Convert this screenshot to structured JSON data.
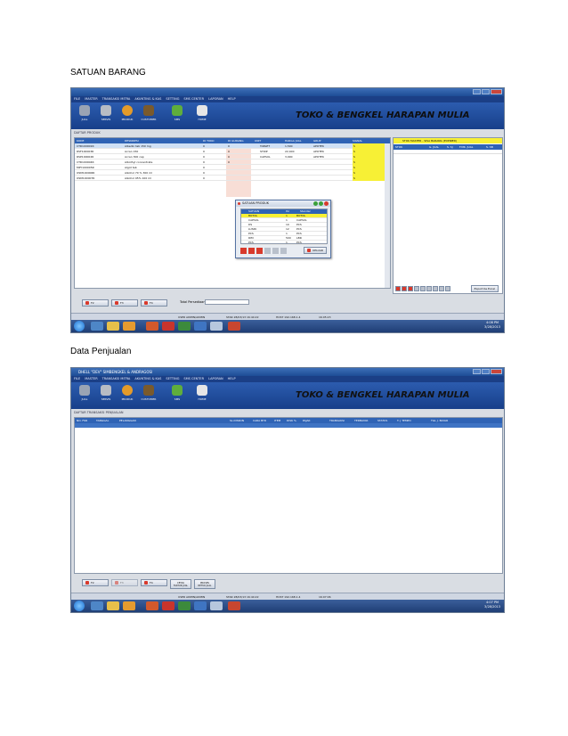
{
  "captions": {
    "first": "SATUAN BARANG",
    "second": "Data Penjualan"
  },
  "app": {
    "menu": [
      "FILE",
      "MASTER",
      "TRANSAKSI MITRA",
      "AKUNTING & KAS",
      "SETTING",
      "SMS CENTER",
      "LAPORAN",
      "HELP"
    ],
    "toolbar": [
      "JUAL",
      "SERVIS",
      "PRODUK",
      "CUSTOMER",
      "SMS",
      "HOME"
    ],
    "brand": "TOKO & BENGKEL HARAPAN MULIA"
  },
  "shot1": {
    "panel_title": "DAFTAR PRODUK",
    "columns": [
      "KODE",
      "DESKRIPSI",
      "DI TOKO",
      "DI GUDANG",
      "UNIT",
      "HARGA JUAL",
      "GRUP",
      "SIGNAL"
    ],
    "rows": [
      [
        "CTR100001R",
        "Albedin tab 150 mg",
        "0",
        "0",
        "TABLET",
        "1,500",
        "APOTEK",
        "S"
      ],
      [
        "RSF100003R",
        "Acran 150",
        "0",
        "0",
        "STRIP",
        "22,400",
        "APOTEK",
        "S"
      ],
      [
        "RSP100002R",
        "Acran 300 cap",
        "0",
        "0",
        "CAPSUL",
        "3,990",
        "APOTEK",
        "S"
      ],
      [
        "CTR100004R",
        "Albothyl concentrate",
        "0",
        "0",
        "",
        "",
        "",
        "S"
      ],
      [
        "MPY100005R",
        "Algot tab",
        "0",
        "",
        "",
        "",
        "",
        "S"
      ],
      [
        "OSM100006R",
        "Alkohol 70 % 300 ml",
        "0",
        "",
        "",
        "",
        "",
        "S"
      ],
      [
        "OSM100007R",
        "Alkohol 95% 100 ml",
        "0",
        "",
        "",
        "",
        "",
        "S"
      ]
    ],
    "side_title": "STOK MASTER - SISA BARANG (EXPIRED)",
    "side_columns": [
      "STOK",
      "G. JUAL",
      "S. SJ",
      "F.MK. JUAL",
      "S. SB"
    ],
    "side_button": "Export Ke Excel",
    "dialog": {
      "title": "SATUAN PRODUK",
      "columns": [
        "SATUAN",
        "ISI",
        "Standar"
      ],
      "rows": [
        [
          "BOTOL",
          "1",
          "BOTOL"
        ],
        [
          "CAPSUL",
          "1",
          "CAPSUL"
        ],
        [
          "DS",
          "10",
          "PCS"
        ],
        [
          "LUSIN",
          "12",
          "PCS"
        ],
        [
          "PCS",
          "1",
          "PCS"
        ],
        [
          "RIM",
          "500",
          "LBR"
        ],
        [
          "PCS",
          "1",
          "PCS"
        ]
      ],
      "close_label": "KELUAR"
    },
    "buttons": [
      "F2",
      "F3",
      "F4"
    ],
    "total_label": "Total Persediaan :",
    "status": [
      "USER ADMIN/ADMIN",
      "STAR 28/03/13 16:44:22",
      "HOST 192.168.1.4",
      "16:05:23"
    ],
    "clock": [
      "4:08 PM",
      "3/28/2013"
    ]
  },
  "shot2": {
    "title": "DHELL \"DEV\" SIMBENGKEL & ANDRAGOSI",
    "panel_title": "DAFTAR TRANSAKSI PENJUALAN",
    "columns": [
      "NO. FKR",
      "TANGGAL",
      "PELANGGAN",
      "SL.DISKON",
      "CARA BYR",
      "ITEM",
      "DISK %",
      "PAJAK",
      "TRANSAKSI",
      "TERBAYAR",
      "STATUS",
      "T. J TEMPO",
      "TGL J. BAYAR"
    ],
    "buttons": [
      "F2",
      "F3",
      "F4"
    ],
    "extra_buttons": [
      "CETAK FAKTUR JUAL",
      "PROSES RETUR JUAL"
    ],
    "status": [
      "USER ADMIN/ADMIN",
      "STAR 28/03/13 16:44:22",
      "HOST 192.168.1.4",
      "16:07:06"
    ],
    "clock": [
      "4:07 PM",
      "3/28/2013"
    ]
  }
}
